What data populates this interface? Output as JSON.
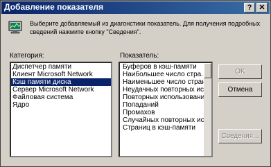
{
  "window": {
    "title": "Добавление показателя",
    "help_label": "?",
    "close_label": "✕"
  },
  "info": {
    "text": "Выберите добавляемый из диагонстики показатель. Для получения подробных сведений нажмите кнопку \"Сведения\"."
  },
  "category": {
    "label": "Категория:",
    "items": [
      {
        "label": "Диспетчер памяти",
        "selected": false
      },
      {
        "label": "Клиент Microsoft Network",
        "selected": false
      },
      {
        "label": "Кэш памяти диска",
        "selected": true
      },
      {
        "label": "Сервер Microsoft Network",
        "selected": false
      },
      {
        "label": "Файловая система",
        "selected": false
      },
      {
        "label": "Ядро",
        "selected": false
      }
    ]
  },
  "indicator": {
    "label": "Показатель:",
    "items": [
      {
        "label": "Буферов в кэш-памяти"
      },
      {
        "label": "Наибольшее число стра..."
      },
      {
        "label": "Наименьшее число страниц"
      },
      {
        "label": "Неудачных повторных испо..."
      },
      {
        "label": "Повторных использований"
      },
      {
        "label": "Попаданий"
      },
      {
        "label": "Промахов"
      },
      {
        "label": "Случайных повторных испо..."
      },
      {
        "label": "Страниц в кэш-памяти"
      }
    ],
    "scroll_position": 0.0
  },
  "buttons": {
    "ok": "OK",
    "cancel": "Отмена",
    "details": "Сведения..."
  }
}
